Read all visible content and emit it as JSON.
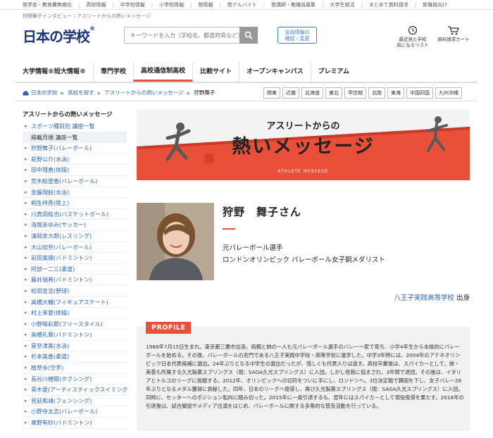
{
  "topnav": [
    "奨学金・教育費無償化",
    "高校情報",
    "中学校情報",
    "小学校情報",
    "塾情報",
    "塾アルバイト",
    "塾講師・教職員募集",
    "大学生就活",
    "まとめて資料請求",
    "新職員向け"
  ],
  "tagline": "狩野舞子インタビュー｜アスリートからの熱いメッセージ",
  "header": {
    "logo_text": "日本の学校",
    "logo_mark": "®",
    "search_placeholder": "キーワードを入力（学校名、都道府県など）",
    "member_button": [
      "会員情報の",
      "確認・変更"
    ],
    "recent_schools": [
      "最近見た学校",
      "気になるリスト"
    ],
    "request_cart": "資料請求カート"
  },
  "mainnav": [
    {
      "line1": "大学情報®",
      "line2": "短大情報®",
      "active": false
    },
    {
      "line1": "専門学校",
      "line2": "",
      "active": false
    },
    {
      "line1": "高校",
      "line2": "通信制高校",
      "active": true
    },
    {
      "line1": "比較サイト",
      "line2": "",
      "active": false
    },
    {
      "line1": "オープン",
      "line2": "キャンパス",
      "active": false
    },
    {
      "line1": "プレミアム",
      "line2": "",
      "active": false
    }
  ],
  "breadcrumb": [
    "日本の学校",
    "高校を探す",
    "アスリートからの熱いメッセージ",
    "狩野舞子"
  ],
  "regions": [
    "関東",
    "近畿",
    "北海道",
    "東北",
    "甲信越",
    "北陸",
    "東海",
    "中国四国",
    "九州沖縄"
  ],
  "sidebar": {
    "title": "アスリートからの熱いメッセージ",
    "items": [
      {
        "label": "スポーツ種目別 講座一覧",
        "hl": false
      },
      {
        "label": "掲載月順 講座一覧",
        "hl": true
      },
      {
        "label": "狩野舞子(バレーボール)",
        "hl": false
      },
      {
        "label": "萩野公介(水泳)",
        "hl": false
      },
      {
        "label": "田中理恵(体操)",
        "hl": false
      },
      {
        "label": "荒木絵里香(バレーボール)",
        "hl": false
      },
      {
        "label": "金藤理絵(水泳)",
        "hl": false
      },
      {
        "label": "桐生祥秀(陸上)",
        "hl": false
      },
      {
        "label": "川真田紘也(バスケットボール)",
        "hl": false
      },
      {
        "label": "海堀あゆみ(サッカー)",
        "hl": false
      },
      {
        "label": "清岡幸大郎(レスリング)",
        "hl": false
      },
      {
        "label": "大山加奈(バレーボール)",
        "hl": false
      },
      {
        "label": "前田美順(バドミントン)",
        "hl": false
      },
      {
        "label": "阿部一二三(柔道)",
        "hl": false
      },
      {
        "label": "藤井瑞希(バドミントン)",
        "hl": false
      },
      {
        "label": "松田宣浩(野球)",
        "hl": false
      },
      {
        "label": "高橋大輔(フィギュアスケート)",
        "hl": false
      },
      {
        "label": "村上茉愛(体操)",
        "hl": false
      },
      {
        "label": "小野塚彩那(フリースタイル)",
        "hl": false
      },
      {
        "label": "高橋礼華(バドミントン)",
        "hl": false
      },
      {
        "label": "星奈津美(水泳)",
        "hl": false
      },
      {
        "label": "杉本美香(柔道)",
        "hl": false
      },
      {
        "label": "植草歩(空手)",
        "hl": false
      },
      {
        "label": "長谷川穂積(ボクシング)",
        "hl": false
      },
      {
        "label": "青木愛(アーティスティックスイミング)",
        "hl": false
      },
      {
        "label": "見延和靖(フェンシング)",
        "hl": false
      },
      {
        "label": "小野寺太志(バレーボール)",
        "hl": false
      },
      {
        "label": "東野有紗(バドミントン)",
        "hl": false
      }
    ]
  },
  "banner": {
    "line1": "アスリートからの",
    "line2": "熱いメッセージ",
    "subtitle": "ATHLETE MESSEGE"
  },
  "profile": {
    "name": "狩野　舞子さん",
    "career": [
      "元バレーボール選手",
      "ロンドンオリンピック バレーボール女子銅メダリスト"
    ],
    "school": "八王子実践高等学校",
    "school_suffix": " 出身",
    "tag": "PROFILE",
    "text": "1988年7月15日生まれ。東京都三鷹市出身。両親と姉の一人も元バレーボール選手のバレー一家で育ち、小学4年生から本格的にバレーボールを始める。その後、バレーボールの名門である八王子実践中学校・高等学校に進学した。中学3年時には、2004年のアテネオリンピック日本代表候補に選出。24年ぶりとなる中学生の選出だったが、惜しくも代表入りは逃す。高校卒業後は、スパイカーとして、姉・美香も所属する久光製薬スプリングス（現：SAGA久光スプリングス）に入団。しかし怪我に悩まされ、3年間で退団。その後は、イタリアとトルコのリーグに挑戦する。2012年、オリンピックへの切符をついに手にし、ロンドンへ。3位決定戦で韓国を下し、女子バレー28年ぶりとなるメダル獲得に貢献した。同年、日本のリーグへ復帰し、再び久光製薬スプリングス（現：SAGA久光スプリングス）に入団。同時に、セッターへのポジション転向に踏み切った。2015年に一度引退するも、翌年にはスパイカーとして現役復帰を果たす。2018年の引退後は、試合解説やメディア出演をはじめ、バレーボールに関する多角的な普及活動を行っている。"
  },
  "colors": {
    "accent": "#e8503a",
    "brand": "#18357c",
    "link": "#2a63b5"
  }
}
